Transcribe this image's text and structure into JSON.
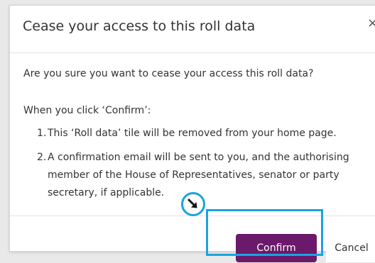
{
  "dialog": {
    "title": "Cease your access to this roll data",
    "close_glyph": "×",
    "question": "Are you sure you want to cease your access this roll data?",
    "lead": "When you click ‘Confirm’:",
    "items": [
      {
        "number": "1.",
        "text": "This ‘Roll data’ tile will be removed from your home page."
      },
      {
        "number": "2.",
        "text": "A confirmation email will be sent to you, and the authorising member of the House of Representatives, senator or party secretary, if applicable."
      }
    ],
    "confirm_label": "Confirm",
    "cancel_label": "Cancel"
  },
  "annotation": {
    "highlight_color": "#1aa3e0",
    "pointer_icon": "arrow-down-right-icon"
  },
  "colors": {
    "accent": "#6b1a6b"
  }
}
